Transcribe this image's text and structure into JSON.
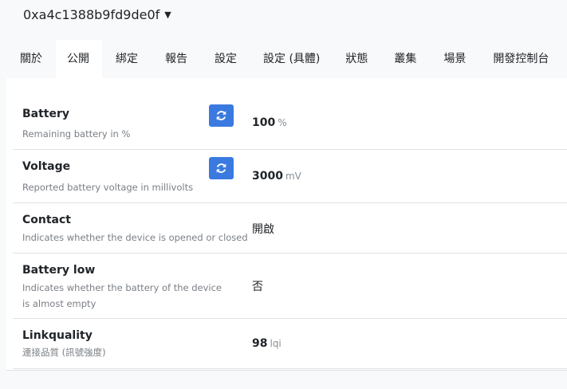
{
  "header": {
    "device_id": "0xa4c1388b9fd9de0f",
    "chevron_icon": "chevron-down-icon"
  },
  "tabs": [
    {
      "label": "關於",
      "active": false
    },
    {
      "label": "公開",
      "active": true
    },
    {
      "label": "綁定",
      "active": false
    },
    {
      "label": "報告",
      "active": false
    },
    {
      "label": "設定",
      "active": false
    },
    {
      "label": "設定 (具體)",
      "active": false
    },
    {
      "label": "狀態",
      "active": false
    },
    {
      "label": "叢集",
      "active": false
    },
    {
      "label": "場景",
      "active": false
    },
    {
      "label": "開發控制台",
      "active": false
    }
  ],
  "exposes": [
    {
      "label": "Battery",
      "description": "Remaining battery in %",
      "value": "100",
      "unit": "%",
      "refresh_icon": "refresh-icon"
    },
    {
      "label": "Voltage",
      "description": "Reported battery voltage in millivolts",
      "value": "3000",
      "unit": "mV",
      "refresh_icon": "refresh-icon"
    },
    {
      "label": "Contact",
      "description": "Indicates whether the device is opened or closed",
      "value": "開啟"
    },
    {
      "label": "Battery low",
      "description": "Indicates whether the battery of the device is almost empty",
      "value": "否"
    },
    {
      "label": "Linkquality",
      "description": "連接品質 (訊號強度)",
      "value": "98",
      "unit": "lqi"
    }
  ],
  "colors": {
    "accent": "#3a7ae0",
    "page_background": "#f8f9fa",
    "panel_background": "#ffffff",
    "muted_text": "#7a7f85"
  }
}
